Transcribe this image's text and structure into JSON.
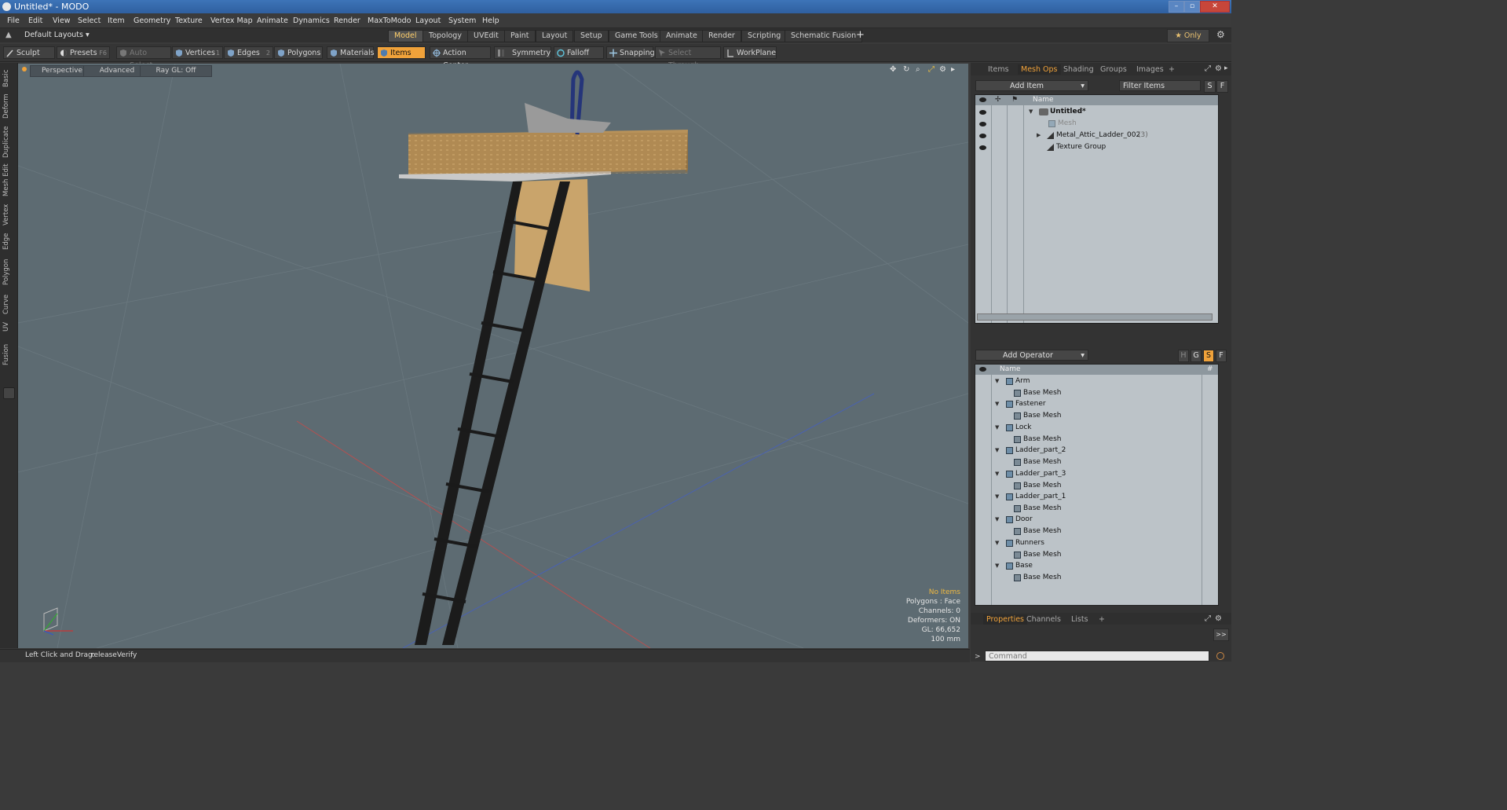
{
  "window": {
    "title": "Untitled* - MODO",
    "min": "–",
    "max": "▫",
    "close": "✕"
  },
  "menu": [
    "File",
    "Edit",
    "View",
    "Select",
    "Item",
    "Geometry",
    "Texture",
    "Vertex Map",
    "Animate",
    "Dynamics",
    "Render",
    "MaxToModo",
    "Layout",
    "System",
    "Help"
  ],
  "layout_selector": "Default Layouts ▾",
  "layout_tabs": [
    {
      "label": "Model",
      "active": true
    },
    {
      "label": "Topology"
    },
    {
      "label": "UVEdit"
    },
    {
      "label": "Paint"
    },
    {
      "label": "Layout"
    },
    {
      "label": "Setup"
    },
    {
      "label": "Game Tools"
    },
    {
      "label": "Animate"
    },
    {
      "label": "Render"
    },
    {
      "label": "Scripting"
    },
    {
      "label": "Schematic Fusion"
    }
  ],
  "layout_add": "+",
  "only_label": "★ Only",
  "toolbar": {
    "sculpt": "Sculpt",
    "presets": "Presets",
    "presets_key": "F6",
    "auto_select": "Auto Select",
    "vertices": "Vertices",
    "vertices_key": "1",
    "edges": "Edges",
    "edges_key": "2",
    "polygons": "Polygons",
    "materials": "Materials",
    "items": "Items",
    "action_center": "Action Center",
    "symmetry": "Symmetry",
    "falloff": "Falloff",
    "snapping": "Snapping",
    "select_through": "Select Through",
    "workplane": "WorkPlane"
  },
  "left_tabs": [
    "Basic",
    "Deform",
    "Duplicate",
    "Mesh Edit",
    "Vertex",
    "Edge",
    "Polygon",
    "Curve",
    "UV",
    "Fusion"
  ],
  "viewport": {
    "view": "Perspective",
    "advanced": "Advanced",
    "raygl": "Ray GL: Off",
    "stats": {
      "items": "No Items",
      "polygons": "Polygons : Face",
      "channels": "Channels: 0",
      "deformers": "Deformers: ON",
      "gl": "GL: 66,652",
      "scale": "100 mm"
    }
  },
  "status": {
    "hint": "Left Click and Drag:",
    "action": "releaseVerify"
  },
  "right": {
    "top_tabs": [
      {
        "label": "Items"
      },
      {
        "label": "Mesh Ops",
        "active": true
      },
      {
        "label": "Shading"
      },
      {
        "label": "Groups"
      },
      {
        "label": "Images"
      },
      {
        "label": "+"
      }
    ],
    "add_item": "Add Item",
    "filter_items": "Filter Items",
    "btn_s": "S",
    "btn_f": "F",
    "items_header": "Name",
    "items": [
      {
        "name": "Untitled*",
        "bold": true,
        "indent": 0,
        "expander": "▼"
      },
      {
        "name": "Mesh",
        "dim": true,
        "indent": 1,
        "expander": ""
      },
      {
        "name": "Metal_Attic_Ladder_002",
        "suffix": "(3)",
        "indent": 1,
        "expander": "▶"
      },
      {
        "name": "Texture Group",
        "indent": 1,
        "expander": ""
      }
    ],
    "add_operator": "Add Operator",
    "op_btns": [
      "H",
      "G",
      "S",
      "F"
    ],
    "ops_header": "Name",
    "ops_hash": "#",
    "ops": [
      {
        "name": "Arm",
        "child": "Base Mesh"
      },
      {
        "name": "Fastener",
        "child": "Base Mesh"
      },
      {
        "name": "Lock",
        "child": "Base Mesh"
      },
      {
        "name": "Ladder_part_2",
        "child": "Base Mesh"
      },
      {
        "name": "Ladder_part_3",
        "child": "Base Mesh"
      },
      {
        "name": "Ladder_part_1",
        "child": "Base Mesh"
      },
      {
        "name": "Door",
        "child": "Base Mesh"
      },
      {
        "name": "Runners",
        "child": "Base Mesh"
      },
      {
        "name": "Base",
        "child": "Base Mesh"
      }
    ],
    "bottom_tabs": [
      {
        "label": "Properties",
        "active": true
      },
      {
        "label": "Channels"
      },
      {
        "label": "Lists"
      },
      {
        "label": "+"
      }
    ],
    "expand": ">>",
    "command_placeholder": "Command"
  },
  "colors": {
    "accent": "#f0a23a",
    "viewport_bg": "#5d6b72",
    "titlebar": "#3d74b8"
  }
}
